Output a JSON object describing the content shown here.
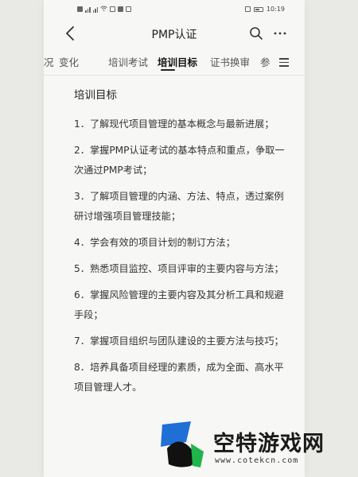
{
  "status_bar": {
    "time": "10:19",
    "battery_level": 0.4
  },
  "navbar": {
    "back_icon": "chevron-left-icon",
    "title": "PMP认证",
    "search_icon": "search-icon",
    "more_icon": "more-horizontal-icon"
  },
  "tabs": {
    "items": [
      {
        "label": "况"
      },
      {
        "label": "变化"
      },
      {
        "label": "培训考试"
      },
      {
        "label": "培训目标",
        "active": true
      },
      {
        "label": "证书换审"
      },
      {
        "label": "参"
      }
    ],
    "menu_icon": "menu-icon"
  },
  "content": {
    "heading": "培训目标",
    "items": [
      {
        "text": "1．了解现代项目管理的基本概念与最新进展；"
      },
      {
        "text": "2．掌握PMP认证考试的基本特点和重点，争取一次通过PMP考试；"
      },
      {
        "text": "3．了解项目管理的内涵、方法、特点，透过案例研讨增强项目管理技能；"
      },
      {
        "text": "4．学会有效的项目计划的制订方法；"
      },
      {
        "text": "5．熟悉项目监控、项目评审的主要内容与方法；"
      },
      {
        "text": "6．掌握风险管理的主要内容及其分析工具和规避手段；"
      },
      {
        "text": "7．掌握项目组织与团队建设的主要方法与技巧；"
      },
      {
        "text": "8．培养具备项目经理的素质，成为全面、高水平项目管理人才。"
      }
    ]
  },
  "watermark": {
    "text": "空特游戏网",
    "url": "www.cotekcn.com",
    "colors": {
      "blue": "#1f6fd6",
      "green": "#1fb54a"
    }
  }
}
